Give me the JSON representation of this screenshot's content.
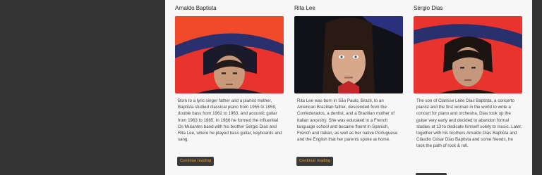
{
  "cards": [
    {
      "name": "Arnaldo Baptista",
      "bio": "Born to a lyric singer father and a pianist mother, Baptista studied classical piano from 1955 to 1959, double bass from 1962 to 1963, and acoustic guitar from 1963 to 1965. In 1966 he formed the influential Os Mutantes band with his brother Sérgio Dias and Rita Lee, where he played bass guitar, keyboards and sang.",
      "button": "Continue reading"
    },
    {
      "name": "Rita Lee",
      "bio": "Rita Lee was born in São Paulo, Brazil, to an American Brazilian father, descended from the Confederados, a dentist, and a Brazilian mother of Italian ancestry. She was educated in a French language school and became fluent in Spanish, French and Italian, as well as her native Portuguese and the English that her parents spoke at home.",
      "button": "Continue reading"
    },
    {
      "name": "Sérgio Dias",
      "bio": "The son of Clarisse Leite Dias Baptista, a concerto pianist and the first woman in the world to write a concert for piano and orchestra, Dias took up the guitar very early and decided to abandon formal studies at 13 to dedicate himself solely to music. Later, together with his brothers Arnaldo Dias Baptista and Cláudio César Dias Baptista and some friends, he took the path of rock & roll.",
      "button": ""
    }
  ]
}
